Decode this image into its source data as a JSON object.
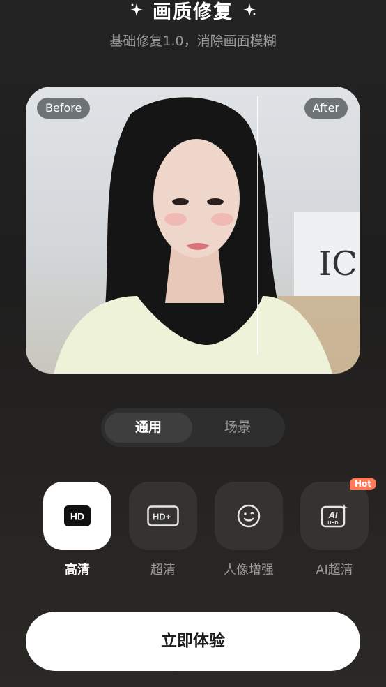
{
  "header": {
    "title": "画质修复",
    "subtitle": "基础修复1.0，消除画面模糊"
  },
  "preview": {
    "before_label": "Before",
    "after_label": "After"
  },
  "tabs": [
    {
      "label": "通用",
      "active": true
    },
    {
      "label": "场景",
      "active": false
    }
  ],
  "options": [
    {
      "label": "高清",
      "icon": "hd-icon",
      "selected": true
    },
    {
      "label": "超清",
      "icon": "hd-plus-icon",
      "selected": false
    },
    {
      "label": "人像增强",
      "icon": "face-icon",
      "selected": false
    },
    {
      "label": "AI超清",
      "icon": "ai-uhd-icon",
      "selected": false,
      "badge": "Hot"
    }
  ],
  "cta": {
    "label": "立即体验"
  },
  "colors": {
    "accent": "#ff7a58",
    "cta_bg": "#ffffff"
  }
}
